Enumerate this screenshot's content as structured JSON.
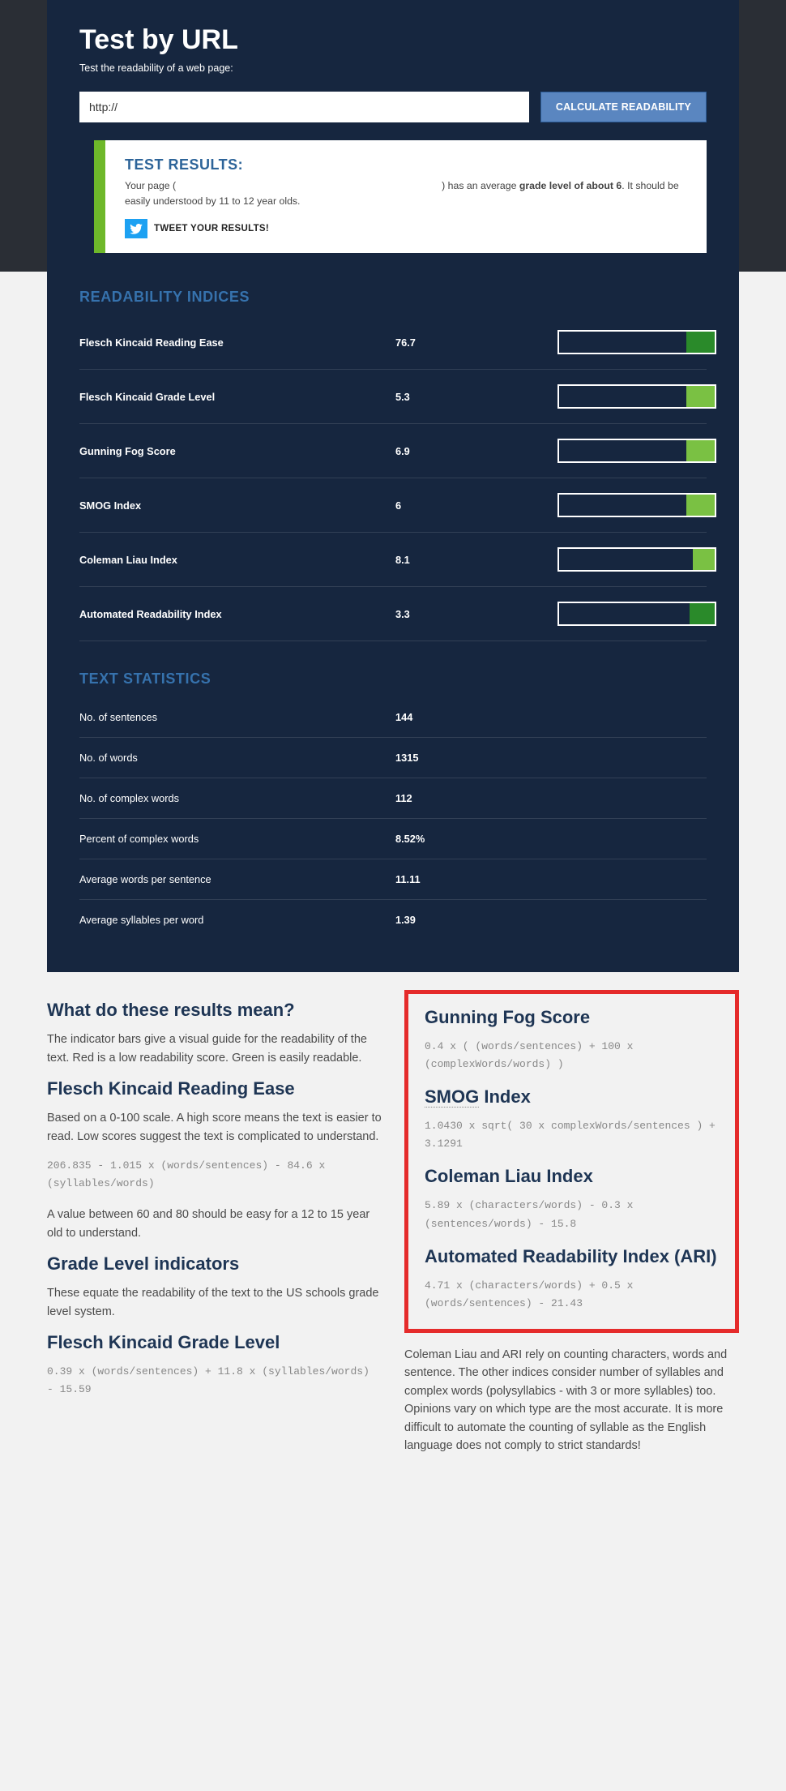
{
  "header": {
    "title": "Test by URL",
    "subtitle": "Test the readability of a web page:",
    "url_value": "http://",
    "calc_label": "CALCULATE READABILITY"
  },
  "results": {
    "heading": "TEST RESULTS:",
    "line_pre": "Your page (",
    "line_post": ") has an average ",
    "bold1": "grade level of about 6",
    "line_tail": ". It should be easily understood by 11 to 12 year olds.",
    "tweet_label": "TWEET YOUR RESULTS!"
  },
  "indices": {
    "heading": "READABILITY INDICES",
    "rows": [
      {
        "label": "Flesch Kincaid Reading Ease",
        "value": "76.7",
        "fill_pct": 18,
        "color": "#2a8a2a"
      },
      {
        "label": "Flesch Kincaid Grade Level",
        "value": "5.3",
        "fill_pct": 18,
        "color": "#7ac143"
      },
      {
        "label": "Gunning Fog Score",
        "value": "6.9",
        "fill_pct": 18,
        "color": "#7ac143"
      },
      {
        "label": "SMOG Index",
        "value": "6",
        "fill_pct": 18,
        "color": "#7ac143"
      },
      {
        "label": "Coleman Liau Index",
        "value": "8.1",
        "fill_pct": 14,
        "color": "#7ac143"
      },
      {
        "label": "Automated Readability Index",
        "value": "3.3",
        "fill_pct": 16,
        "color": "#2a8a2a"
      }
    ]
  },
  "stats": {
    "heading": "TEXT STATISTICS",
    "rows": [
      {
        "label": "No. of sentences",
        "value": "144"
      },
      {
        "label": "No. of words",
        "value": "1315"
      },
      {
        "label": "No. of complex words",
        "value": "112"
      },
      {
        "label": "Percent of complex words",
        "value": "8.52%"
      },
      {
        "label": "Average words per sentence",
        "value": "11.11"
      },
      {
        "label": "Average syllables per word",
        "value": "1.39"
      }
    ]
  },
  "explain": {
    "left": {
      "h_what": "What do these results mean?",
      "p_bars": "The indicator bars give a visual guide for the readability of the text. Red is a low readability score. Green is easily readable.",
      "h_fkre": "Flesch Kincaid Reading Ease",
      "p_fkre": "Based on a 0-100 scale. A high score means the text is easier to read. Low scores suggest the text is complicated to understand.",
      "f_fkre": "206.835 - 1.015 x (words/sentences) - 84.6 x (syllables/words)",
      "p_fkre2": "A value between 60 and 80 should be easy for a 12 to 15 year old to understand.",
      "h_grade": "Grade Level indicators",
      "p_grade": "These equate the readability of the text to the US schools grade level system.",
      "h_fkgl": "Flesch Kincaid Grade Level",
      "f_fkgl": "0.39 x (words/sentences) + 11.8 x (syllables/words) - 15.59"
    },
    "right": {
      "h_fog": "Gunning Fog Score",
      "f_fog": "0.4 x ( (words/sentences) + 100 x (complexWords/words) )",
      "h_smog_pre": "SMOG",
      "h_smog_post": " Index",
      "f_smog": "1.0430 x sqrt( 30 x complexWords/sentences ) + 3.1291",
      "h_cli": "Coleman Liau Index",
      "f_cli": "5.89 x (characters/words) - 0.3 x (sentences/words) - 15.8",
      "h_ari": "Automated Readability Index (ARI)",
      "f_ari": "4.71 x (characters/words) + 0.5 x (words/sentences) - 21.43",
      "p_tail": "Coleman Liau and ARI rely on counting characters, words and sentence. The other indices consider number of syllables and complex words (polysyllabics - with 3 or more syllables) too. Opinions vary on which type are the most accurate. It is more difficult to automate the counting of syllable as the English language does not comply to strict standards!"
    }
  }
}
